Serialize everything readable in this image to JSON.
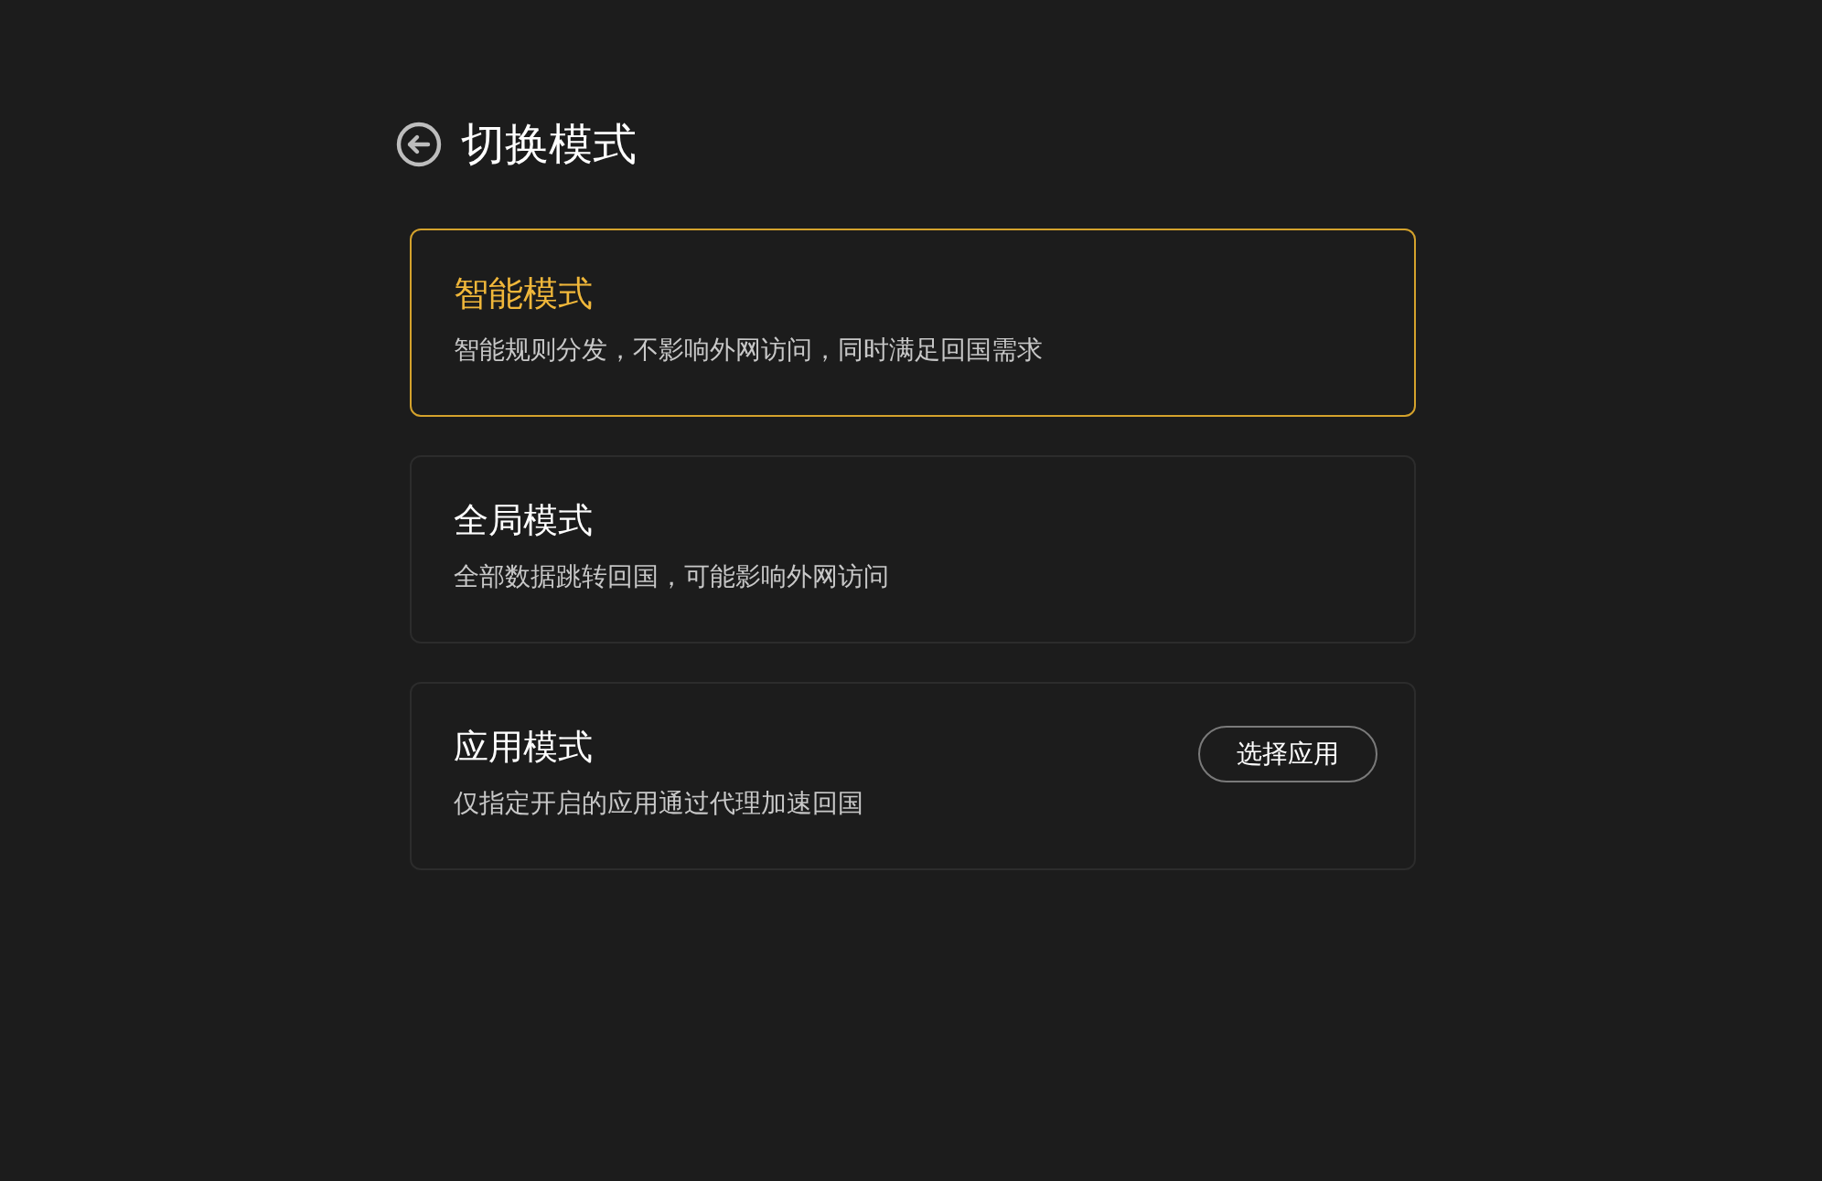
{
  "header": {
    "title": "切换模式"
  },
  "modes": [
    {
      "title": "智能模式",
      "description": "智能规则分发，不影响外网访问，同时满足回国需求",
      "selected": true
    },
    {
      "title": "全局模式",
      "description": "全部数据跳转回国，可能影响外网访问",
      "selected": false
    },
    {
      "title": "应用模式",
      "description": "仅指定开启的应用通过代理加速回国",
      "selected": false,
      "action": "选择应用"
    }
  ]
}
